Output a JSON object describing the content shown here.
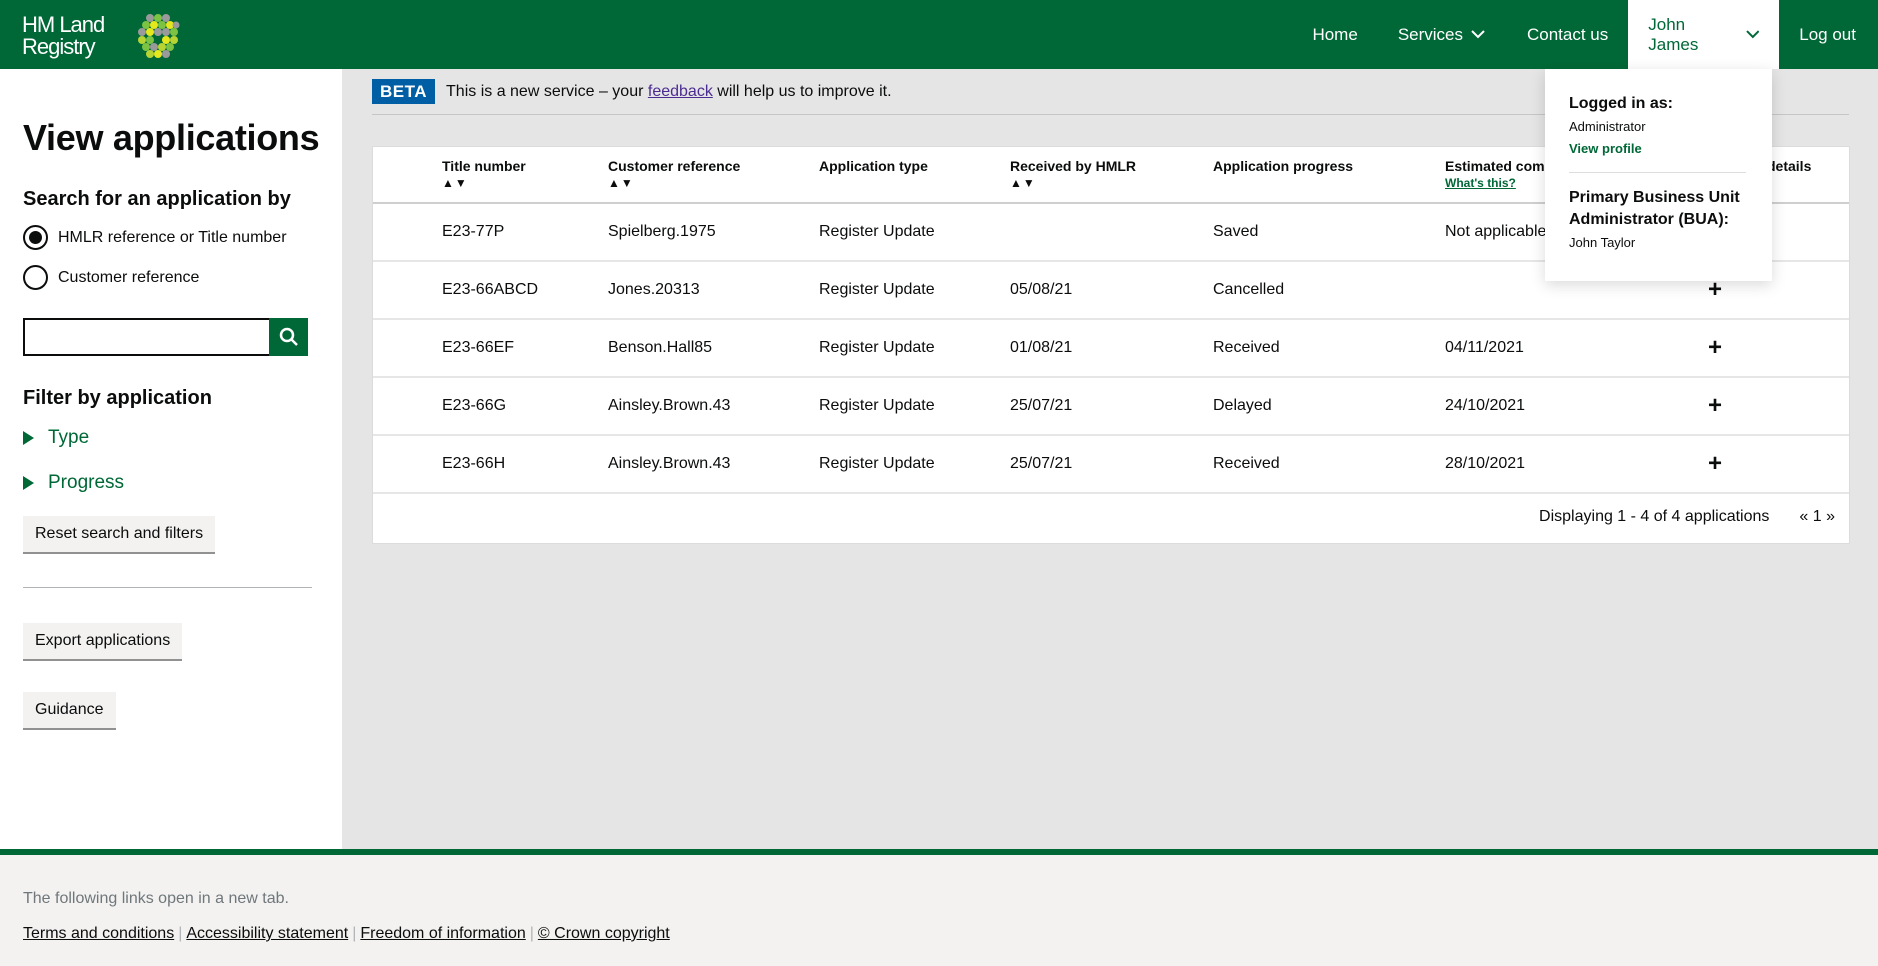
{
  "header": {
    "logo_line1": "HM Land",
    "logo_line2": "Registry",
    "nav": {
      "home": "Home",
      "services": "Services",
      "contact": "Contact us",
      "user": "John James",
      "logout": "Log out"
    },
    "brand_color": "#006837"
  },
  "user_dropdown": {
    "logged_in_label": "Logged in as:",
    "role": "Administrator",
    "view_profile": "View profile",
    "bua_label": "Primary Business Unit Administrator (BUA):",
    "bua_name": "John Taylor"
  },
  "sidebar": {
    "title": "View applications",
    "search_heading": "Search for an application by",
    "radio_options": [
      {
        "label": "HMLR reference or Title number",
        "selected": true
      },
      {
        "label": "Customer reference",
        "selected": false
      }
    ],
    "search_value": "",
    "filter_heading": "Filter by application",
    "filters": [
      "Type",
      "Progress"
    ],
    "reset_button": "Reset search and filters",
    "export_button": "Export applications",
    "guidance_button": "Guidance"
  },
  "banner": {
    "tag": "BETA",
    "text_before": "This is a new service – your ",
    "link": "feedback",
    "text_after": " will help us to improve it."
  },
  "table": {
    "columns": [
      {
        "label": "Title number",
        "sortable": true
      },
      {
        "label": "Customer reference",
        "sortable": true
      },
      {
        "label": "Application type",
        "sortable": false
      },
      {
        "label": "Received by HMLR",
        "sortable": true
      },
      {
        "label": "Application progress",
        "sortable": false
      },
      {
        "label": "Estimated compl",
        "sortable": false,
        "help_link": "What's this?"
      },
      {
        "label": "details",
        "sortable": false
      }
    ],
    "sort_glyph": "▲▼",
    "rows": [
      {
        "title": "E23-77P",
        "customer_ref": "Spielberg.1975",
        "type": "Register Update",
        "received": "",
        "progress": "Saved",
        "estimated": "Not applicable",
        "expand": "+"
      },
      {
        "title": "E23-66ABCD",
        "customer_ref": "Jones.20313",
        "type": "Register Update",
        "received": "05/08/21",
        "progress": "Cancelled",
        "estimated": "",
        "expand": "+"
      },
      {
        "title": "E23-66EF",
        "customer_ref": "Benson.Hall85",
        "type": "Register Update",
        "received": "01/08/21",
        "progress": "Received",
        "estimated": "04/11/2021",
        "expand": "+"
      },
      {
        "title": "E23-66G",
        "customer_ref": "Ainsley.Brown.43",
        "type": "Register Update",
        "received": "25/07/21",
        "progress": "Delayed",
        "estimated": "24/10/2021",
        "expand": "+"
      },
      {
        "title": "E23-66H",
        "customer_ref": "Ainsley.Brown.43",
        "type": "Register Update",
        "received": "25/07/21",
        "progress": "Received",
        "estimated": "28/10/2021",
        "expand": "+"
      }
    ],
    "summary": "Displaying 1 - 4 of 4 applications",
    "pagination": "« 1 »"
  },
  "footer": {
    "note": "The following links open in a new tab.",
    "links": [
      "Terms and conditions",
      "Accessibility statement",
      "Freedom of information",
      "© Crown copyright"
    ]
  }
}
